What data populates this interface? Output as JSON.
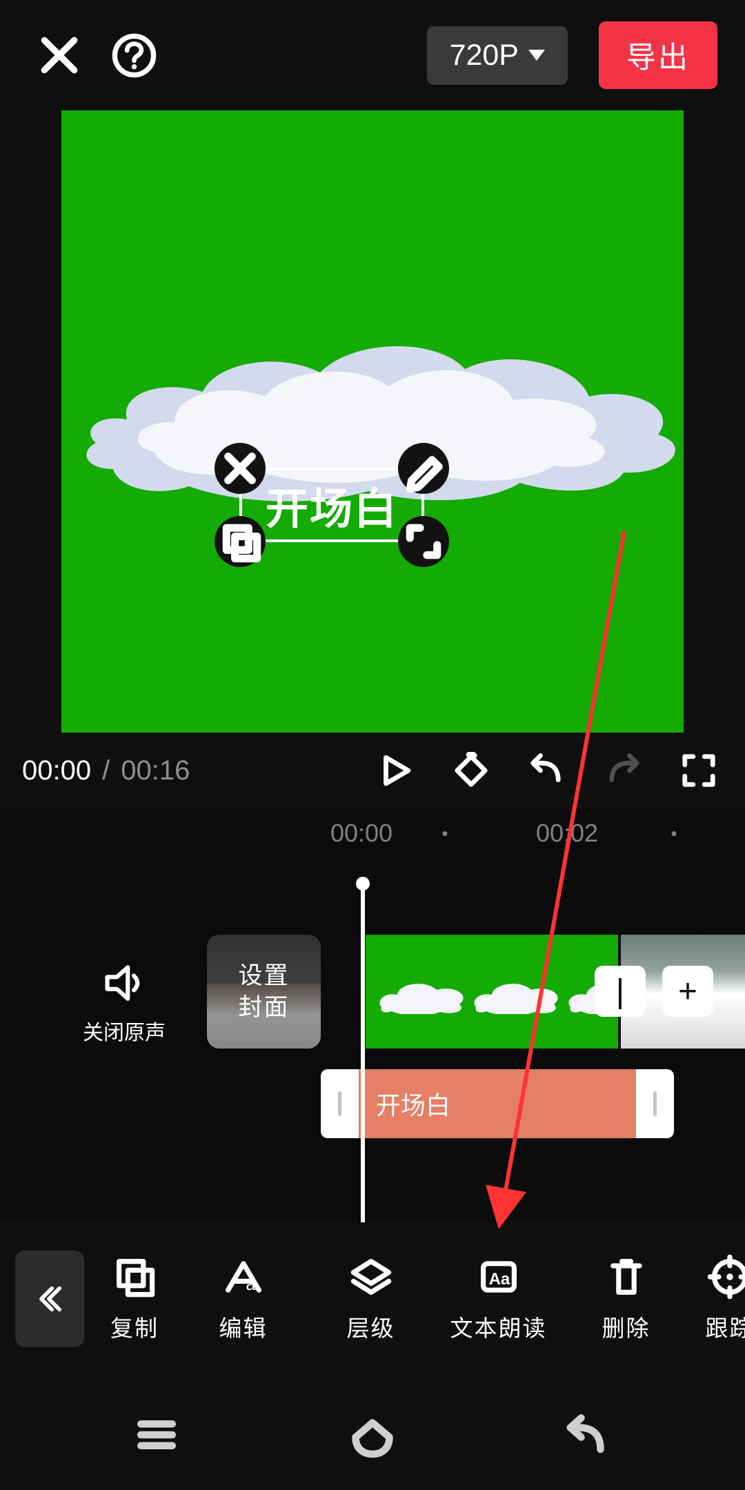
{
  "top": {
    "resolution_label": "720P",
    "export_label": "导出"
  },
  "preview": {
    "text_overlay": "开场白"
  },
  "playback": {
    "current_time": "00:00",
    "separator": "/",
    "total_time": "00:16"
  },
  "timeline": {
    "marks": [
      {
        "label": "00:00",
        "pos": 524,
        "type": "label"
      },
      {
        "pos": 645,
        "type": "dot"
      },
      {
        "label": "00:02",
        "pos": 822,
        "type": "label"
      },
      {
        "pos": 977,
        "type": "dot"
      }
    ],
    "mute_label": "关闭原声",
    "cover_line1": "设置",
    "cover_line2": "封面",
    "text_segment_label": "开场白",
    "minus_label": "|",
    "plus_label": "+"
  },
  "tools": {
    "items": [
      {
        "icon": "copy",
        "label": "复制"
      },
      {
        "icon": "edit",
        "label": "编辑"
      },
      {
        "icon": "layer",
        "label": "层级"
      },
      {
        "icon": "tts",
        "label": "文本朗读"
      },
      {
        "icon": "delete",
        "label": "删除"
      },
      {
        "icon": "track",
        "label": "跟踪"
      }
    ]
  }
}
